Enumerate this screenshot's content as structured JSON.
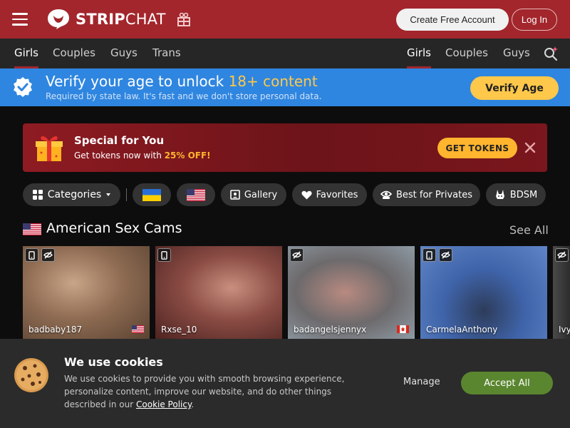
{
  "header": {
    "logo_strip": "STRIP",
    "logo_chat": "CHAT",
    "create_account": "Create Free Account",
    "login": "Log In"
  },
  "nav": {
    "left": [
      "Girls",
      "Couples",
      "Guys",
      "Trans"
    ],
    "right": [
      "Girls",
      "Couples",
      "Guys"
    ]
  },
  "verify": {
    "title_prefix": "Verify your age to unlock ",
    "title_highlight": "18+ content",
    "subtitle": "Required by state law. It's fast and we don't store personal data.",
    "button": "Verify Age"
  },
  "promo": {
    "title": "Special for You",
    "subtitle_prefix": "Get tokens now with ",
    "subtitle_highlight": "25% OFF!",
    "button": "GET TOKENS"
  },
  "filters": {
    "categories": "Categories",
    "gallery": "Gallery",
    "favorites": "Favorites",
    "best_for_privates": "Best for Privates",
    "bdsm": "BDSM"
  },
  "section": {
    "title": "American Sex Cams",
    "see_all": "See All"
  },
  "cams": [
    {
      "name": "badbaby187",
      "flag": "us"
    },
    {
      "name": "Rxse_10",
      "flag": ""
    },
    {
      "name": "badangelsjennyx",
      "flag": "ca"
    },
    {
      "name": "CarmelaAnthony",
      "flag": ""
    },
    {
      "name": "Ivy",
      "flag": ""
    }
  ],
  "cookie": {
    "title": "We use cookies",
    "text": "We use cookies to provide you with smooth browsing experience, personalize content, improve our website, and do other things described in our ",
    "link": "Cookie Policy",
    "text_end": ".",
    "manage": "Manage",
    "accept": "Accept All"
  },
  "colors": {
    "brand": "#a2262c",
    "verify_bg": "#2f86e0",
    "highlight": "#ffc84a",
    "tokens": "#ffb52e",
    "accept": "#5a862f"
  },
  "icons": [
    "menu-icon",
    "stripchat-logo-icon",
    "gift-icon",
    "search-sparkle-icon",
    "verified-badge-icon",
    "gift-box-icon",
    "close-icon",
    "grid-icon",
    "ukraine-flag-icon",
    "us-flag-icon",
    "gallery-icon",
    "heart-icon",
    "private-icon",
    "bunny-icon",
    "mobile-icon",
    "hidden-icon",
    "canada-flag-icon",
    "cookie-icon"
  ]
}
